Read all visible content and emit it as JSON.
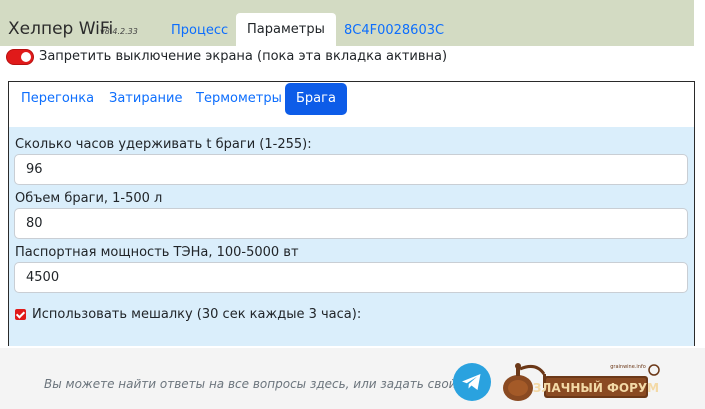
{
  "header": {
    "brand": "Хелпер WiFi",
    "version": "v8.4.2.33",
    "tabs": [
      "Процесс",
      "Параметры",
      "8C4F0028603C"
    ],
    "active_tab": 1
  },
  "screen_lock": {
    "label": "Запретить выключение экрана (пока эта вкладка активна)",
    "enabled": true
  },
  "sub_tabs": {
    "items": [
      "Перегонка",
      "Затирание",
      "Термометры",
      "Брага"
    ],
    "active": 3
  },
  "form": {
    "hold_hours_label": "Сколько часов удерживать t браги (1-255):",
    "hold_hours_value": "96",
    "volume_label": "Объем браги, 1-500 л",
    "volume_value": "80",
    "power_label": "Паспортная мощность ТЭНа, 100-5000 вт",
    "power_value": "4500",
    "mixer_label": "Использовать мешалку (30 сек каждые 3 часа):",
    "mixer_checked": true
  },
  "footer": {
    "text": "Вы можете найти ответы на все вопросы здесь, или задать свой:",
    "telegram_icon": "telegram-icon",
    "forum_logo_text": "ЗЛАЧНЫЙ ФОРУМ",
    "forum_logo_small": "grainwine.info"
  },
  "colors": {
    "navbar": "#d3dbc3",
    "link": "#0d6efd",
    "active_sub_tab": "#0d5ce8",
    "form_bg": "#daeefb",
    "toggle": "#e01a1a",
    "telegram": "#2aa2df"
  }
}
